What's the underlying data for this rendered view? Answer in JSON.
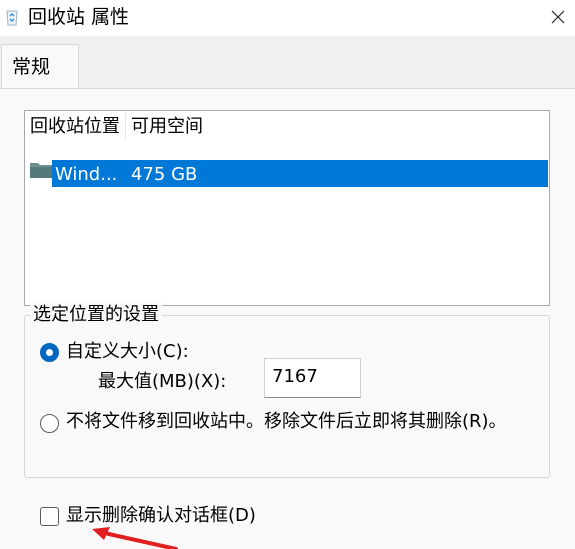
{
  "window": {
    "title": "回收站 属性",
    "close_icon": "close-icon",
    "title_icon": "recycle-bin-icon"
  },
  "tabs": [
    {
      "label": "常规",
      "selected": true
    }
  ],
  "locations_list": {
    "columns": [
      "回收站位置",
      "可用空间"
    ],
    "rows": [
      {
        "location": "Wind...",
        "free_space": "475 GB",
        "icon": "folder-icon",
        "selected": true
      }
    ]
  },
  "settings_group": {
    "title": "选定位置的设置",
    "custom_size": {
      "label": "自定义大小(C):",
      "selected": true
    },
    "max_size": {
      "label": "最大值(MB)(X):",
      "value": "7167"
    },
    "delete_immediately": {
      "label": "不将文件移到回收站中。移除文件后立即将其删除(R)。",
      "selected": false
    }
  },
  "confirm_dialog": {
    "label": "显示删除确认对话框(D)",
    "checked": false
  },
  "colors": {
    "selection": "#0078d7",
    "radio_accent": "#0067c0",
    "annotation_arrow": "#e02020"
  }
}
